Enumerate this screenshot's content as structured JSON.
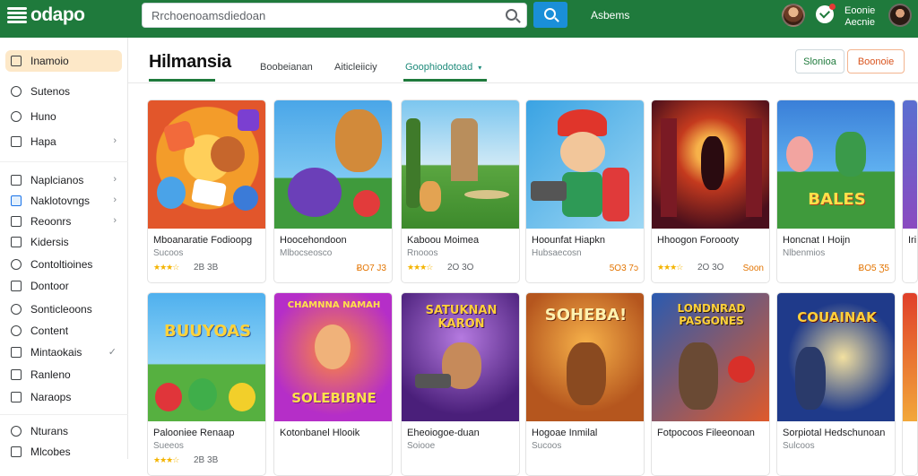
{
  "topbar": {
    "logo": "odapo",
    "search_placeholder": "Rrchoenoamsdiedoan",
    "link": "Asbems",
    "user_name_line1": "Eoonie",
    "user_name_line2": "Aecnie"
  },
  "sidebar": {
    "items": [
      {
        "label": "Inamoio",
        "icon": "document-icon",
        "active": true
      },
      {
        "label": "Sutenos",
        "icon": "user-icon"
      },
      {
        "label": "Huno",
        "icon": "bell-icon"
      },
      {
        "label": "Hapa",
        "icon": "grid-icon",
        "chevron": true
      },
      {
        "label": "Naplcianos",
        "icon": "tag-icon",
        "chevron": true
      },
      {
        "label": "Naklotovngs",
        "icon": "monitor-icon",
        "chevron": true
      },
      {
        "label": "Reoonrs",
        "icon": "list-icon",
        "chevron": true
      },
      {
        "label": "Kidersis",
        "icon": "bookmark-icon"
      },
      {
        "label": "Contoltioines",
        "icon": "chat-icon"
      },
      {
        "label": "Dontoor",
        "icon": "folder-icon"
      },
      {
        "label": "Sonticleoons",
        "icon": "shield-icon"
      },
      {
        "label": "Content",
        "icon": "message-icon"
      },
      {
        "label": "Mintaokais",
        "icon": "calendar-icon",
        "check": true
      },
      {
        "label": "Ranleno",
        "icon": "table-icon"
      },
      {
        "label": "Naraops",
        "icon": "grid2-icon"
      },
      {
        "label": "Nturans",
        "icon": "chat2-icon"
      },
      {
        "label": "Mlcobes",
        "icon": "box-icon"
      }
    ]
  },
  "header": {
    "title": "Hilmansia",
    "tabs": [
      "Boobeianan",
      "Aiticleiiciy",
      "Goophiodotoad"
    ],
    "selected_tab": 2,
    "btn_green": "Slonioa",
    "btn_orange": "Boonoie"
  },
  "cards": [
    {
      "name": "Mboanaratie Fodioopg",
      "sub": "Sucoos",
      "stars": "★★★☆",
      "rating": "2B 3B",
      "price": ""
    },
    {
      "name": "Hoocehondoon",
      "sub": "Mlbocseosco",
      "stars": "",
      "rating": "",
      "price": "ɃO7 J3"
    },
    {
      "name": "Kaboou Moimea",
      "sub": "Rnooos",
      "stars": "★★★☆",
      "rating": "2O 3O",
      "price": ""
    },
    {
      "name": "Hoounfat Hiapkn",
      "sub": "Hubsaecosn",
      "stars": "",
      "rating": "",
      "price": "5O3 7ɔ"
    },
    {
      "name": "Hhoogon Foroooty",
      "sub": "",
      "stars": "★★★☆",
      "rating": "2O 3O",
      "price": "Soon"
    },
    {
      "name": "Honcnat I Hoijn",
      "sub": "Nlbenmios",
      "stars": "",
      "rating": "",
      "price": "ɃO5 Ʒ5"
    },
    {
      "name": "Iri",
      "sub": "",
      "stars": "",
      "rating": "",
      "price": ""
    },
    {
      "name": "Palooniee Renaap",
      "sub": "Sueeos",
      "stars": "★★★☆",
      "rating": "2B 3B",
      "price": ""
    },
    {
      "name": "Kotonbanel Hlooik",
      "sub": "",
      "stars": "",
      "rating": "",
      "price": ""
    },
    {
      "name": "Eheoiogoe-duan",
      "sub": "Soiooe",
      "stars": "",
      "rating": "",
      "price": ""
    },
    {
      "name": "Hogoae Inmilal",
      "sub": "Sucoos",
      "stars": "",
      "rating": "",
      "price": ""
    },
    {
      "name": "Fotpocoos Fileeonoan",
      "sub": "",
      "stars": "",
      "rating": "",
      "price": ""
    },
    {
      "name": "Sorpiotal Hedschunoan",
      "sub": "Sulcoos",
      "stars": "",
      "rating": "",
      "price": ""
    },
    {
      "name": "",
      "sub": "",
      "stars": "",
      "rating": "",
      "price": ""
    }
  ],
  "thumb_texts": {
    "c6": "BALES",
    "c8": "BUUYOAS",
    "c9_top": "CHAMNNA NAMAH",
    "c9_bot": "SOLEBIBNE",
    "c10": "SATUKNAN KARON",
    "c11": "SOHEBA!",
    "c12": "LONDNRAD PASGONES",
    "c13": "COUAINAK"
  },
  "colors": {
    "topbar": "#1f7a3c",
    "accent_blue": "#1a8fd8",
    "active_item_bg": "#fde8c8",
    "star": "#f4b400",
    "price": "#e37400"
  }
}
